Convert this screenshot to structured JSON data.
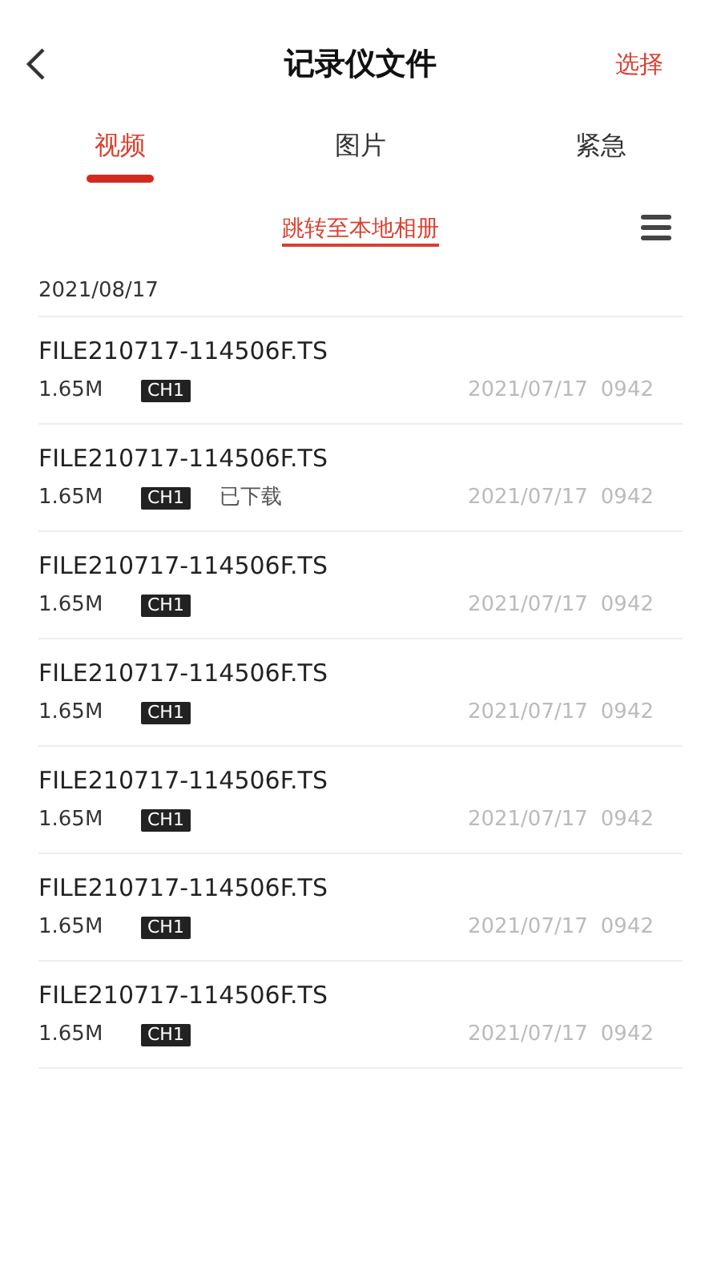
{
  "header": {
    "title": "记录仪文件",
    "action": "选择"
  },
  "tabs": [
    {
      "label": "视频",
      "selected": true
    },
    {
      "label": "图片",
      "selected": false
    },
    {
      "label": "紧急",
      "selected": false
    }
  ],
  "album_link": "跳转至本地相册",
  "date_group": "2021/08/17",
  "files": [
    {
      "name": "FILE210717-114506F.TS",
      "size": "1.65M",
      "channel": "CH1",
      "date": "2021/07/17",
      "time": "0942"
    },
    {
      "name": "FILE210717-114506F.TS",
      "size": "1.65M",
      "channel": "CH1",
      "status": "已下载",
      "date": "2021/07/17",
      "time": "0942"
    },
    {
      "name": "FILE210717-114506F.TS",
      "size": "1.65M",
      "channel": "CH1",
      "date": "2021/07/17",
      "time": "0942"
    },
    {
      "name": "FILE210717-114506F.TS",
      "size": "1.65M",
      "channel": "CH1",
      "date": "2021/07/17",
      "time": "0942"
    },
    {
      "name": "FILE210717-114506F.TS",
      "size": "1.65M",
      "channel": "CH1",
      "date": "2021/07/17",
      "time": "0942"
    },
    {
      "name": "FILE210717-114506F.TS",
      "size": "1.65M",
      "channel": "CH1",
      "date": "2021/07/17",
      "time": "0942"
    },
    {
      "name": "FILE210717-114506F.TS",
      "size": "1.65M",
      "channel": "CH1",
      "date": "2021/07/17",
      "time": "0942"
    }
  ]
}
